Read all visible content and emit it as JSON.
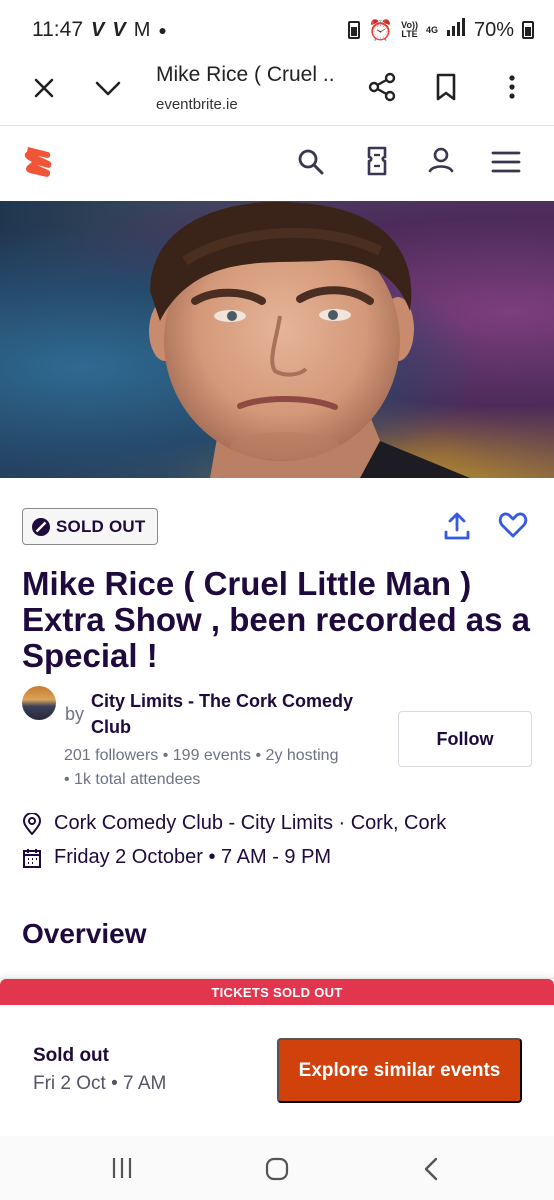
{
  "status_bar": {
    "time": "11:47",
    "notif_icons": [
      "V",
      "V",
      "M"
    ],
    "network_labels": [
      "Vo))",
      "LTE",
      "4G"
    ],
    "battery": "70%"
  },
  "browser": {
    "page_title": "Mike Rice ( Cruel ...",
    "url": "eventbrite.ie"
  },
  "event": {
    "status_badge": "SOLD OUT",
    "title": "Mike Rice ( Cruel Little Man ) Extra Show , been recorded as a Special !",
    "organizer": {
      "by": "by",
      "name": "City Limits - The Cork Comedy Club",
      "stats_line1": "201 followers • 199 events • 2y hosting",
      "stats_line2": "• 1k total attendees",
      "follow_label": "Follow"
    },
    "location": "Cork Comedy Club - City Limits · Cork, Cork",
    "datetime": "Friday 2 October  •  7 AM - 9 PM",
    "overview_heading": "Overview"
  },
  "sticky_bar": {
    "banner": "TICKETS SOLD OUT",
    "status": "Sold out",
    "date": "Fri 2 Oct • 7 AM",
    "cta_label": "Explore similar events"
  },
  "colors": {
    "brand_orange": "#d1410c",
    "soldout_red": "#e2364f",
    "ink": "#1e0a3c",
    "muted": "#6f7287",
    "link_blue": "#3659e3"
  },
  "icons": {
    "browser": [
      "close-icon",
      "chevron-down-icon",
      "share-icon",
      "bookmark-icon",
      "more-vert-icon"
    ],
    "site_header": [
      "eventbrite-logo-icon",
      "search-icon",
      "tickets-icon",
      "user-icon",
      "menu-icon"
    ],
    "event": [
      "ban-icon",
      "upload-share-icon",
      "heart-icon",
      "location-pin-icon",
      "calendar-icon"
    ],
    "android": [
      "recents-icon",
      "home-icon",
      "back-icon"
    ]
  }
}
